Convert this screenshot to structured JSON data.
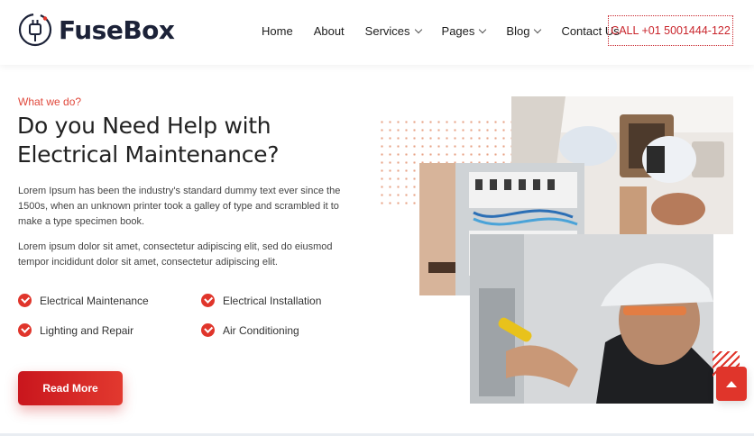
{
  "brand": {
    "name": "FuseBox",
    "accent": "#e0352b",
    "dark": "#1c2238"
  },
  "nav": {
    "items": [
      {
        "label": "Home",
        "dropdown": false
      },
      {
        "label": "About",
        "dropdown": false
      },
      {
        "label": "Services",
        "dropdown": true
      },
      {
        "label": "Pages",
        "dropdown": true
      },
      {
        "label": "Blog",
        "dropdown": true
      },
      {
        "label": "Contact Us",
        "dropdown": false
      }
    ],
    "call_label": "CALL +01 5001444-122"
  },
  "hero": {
    "eyebrow": "What we do?",
    "heading": "Do you Need Help with Electrical Maintenance?",
    "paragraph1": "Lorem Ipsum has been the industry's standard dummy text ever since the 1500s, when an unknown printer took a galley of type and scrambled it to make a type specimen book.",
    "paragraph2": "Lorem ipsum dolor sit amet, consectetur adipiscing elit, sed do eiusmod tempor incididunt dolor sit amet, consectetur adipiscing elit.",
    "features": [
      "Electrical Maintenance",
      "Electrical Installation",
      "Lighting and Repair",
      "Air Conditioning"
    ],
    "button_label": "Read More"
  },
  "icons": {
    "logo": "plug-icon",
    "feature_check": "check-circle-icon",
    "nav_dropdown": "chevron-down-icon",
    "scroll_top": "arrow-up-icon"
  }
}
